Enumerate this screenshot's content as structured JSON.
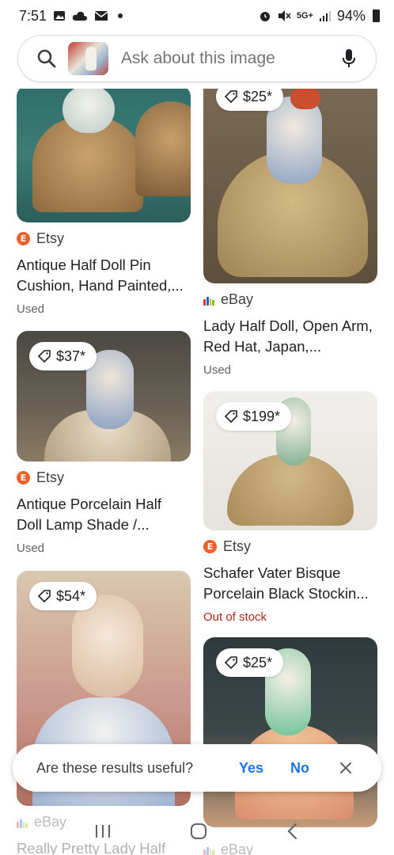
{
  "status_bar": {
    "time": "7:51",
    "network": "5G+",
    "battery": "94%"
  },
  "search": {
    "placeholder": "Ask about this image"
  },
  "results": [
    {
      "price": "",
      "source": "Etsy",
      "title": "Antique Half Doll Pin Cushion, Hand Painted,...",
      "status": "Used"
    },
    {
      "price": "$25*",
      "source": "eBay",
      "title": "Lady Half Doll, Open Arm, Red Hat, Japan,...",
      "status": "Used"
    },
    {
      "price": "$37*",
      "source": "Etsy",
      "title": "Antique Porcelain Half Doll Lamp Shade /...",
      "status": "Used"
    },
    {
      "price": "$199*",
      "source": "Etsy",
      "title": "Schafer Vater Bisque Porcelain Black Stockin...",
      "status": "Out of stock"
    },
    {
      "price": "$54*",
      "source": "eBay",
      "title": "Really Pretty Lady Half",
      "status": ""
    },
    {
      "price": "$25*",
      "source": "eBay",
      "title": "",
      "status": ""
    }
  ],
  "feedback": {
    "question": "Are these results useful?",
    "yes": "Yes",
    "no": "No"
  },
  "colors": {
    "accent": "#1a73e8",
    "out_of_stock": "#b3261e",
    "etsy": "#e8622a"
  },
  "icons": [
    "search-lens-icon",
    "mic-icon",
    "price-tag-icon",
    "close-icon",
    "recents-icon",
    "home-icon",
    "back-icon"
  ]
}
